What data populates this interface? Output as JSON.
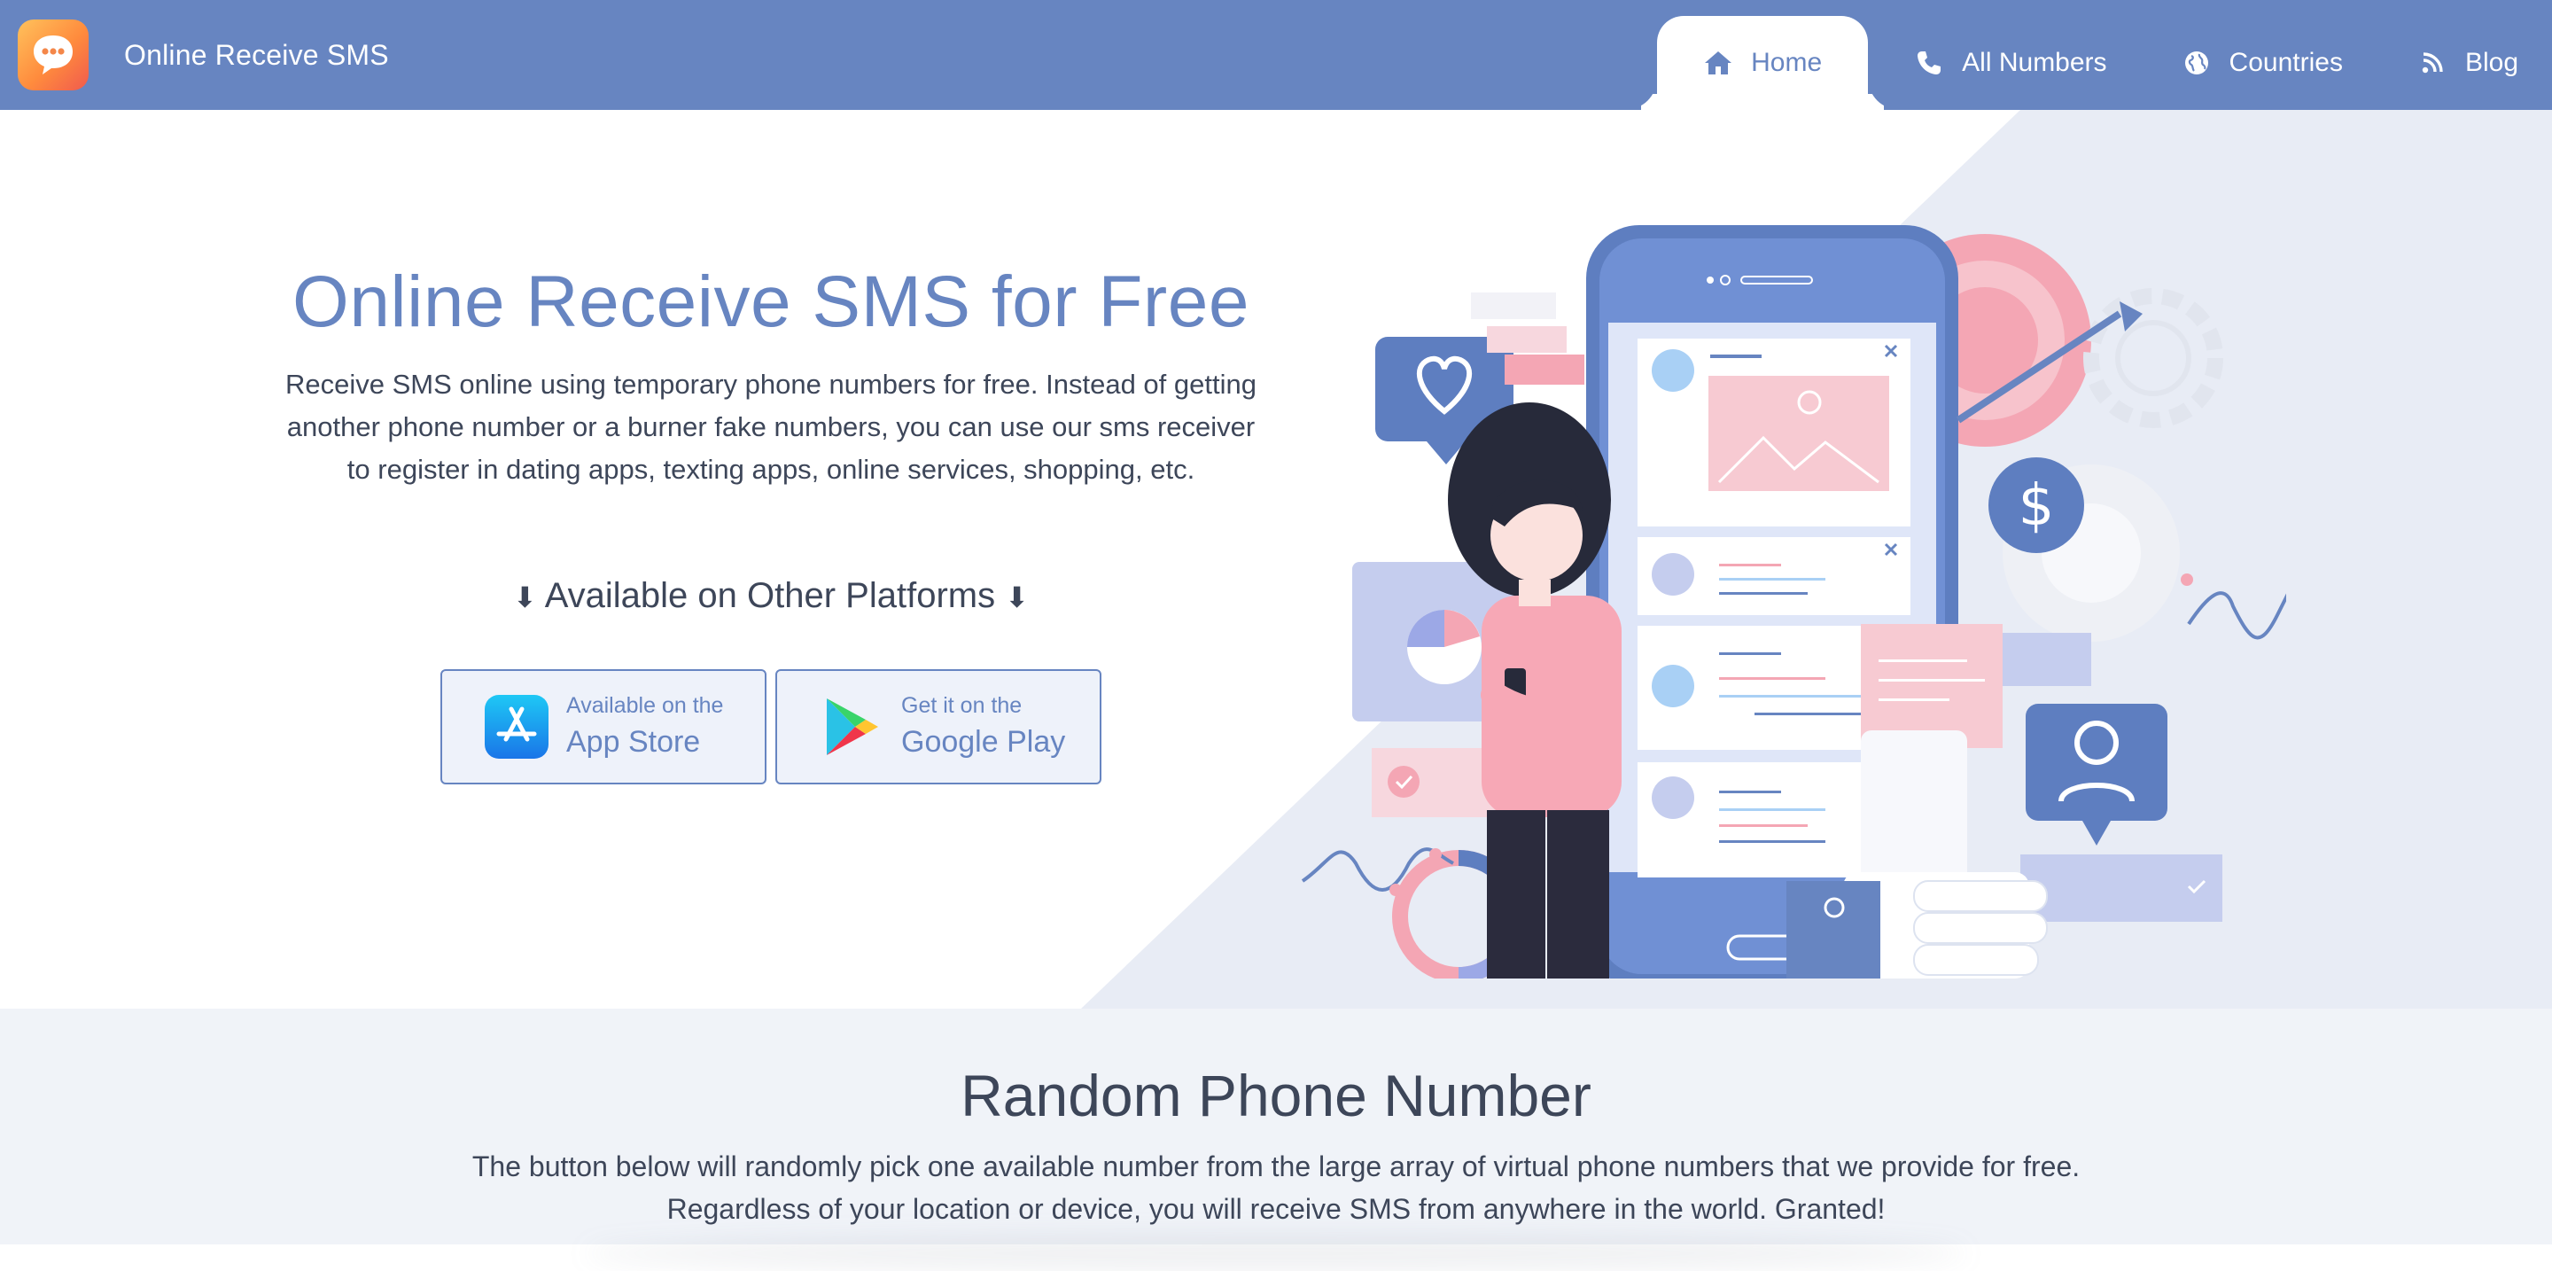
{
  "brand": {
    "name": "Online Receive SMS",
    "icon": "chat-bubble-icon"
  },
  "nav": {
    "items": [
      {
        "label": "Home",
        "icon": "home-icon",
        "active": true
      },
      {
        "label": "All Numbers",
        "icon": "phone-icon",
        "active": false
      },
      {
        "label": "Countries",
        "icon": "globe-icon",
        "active": false
      },
      {
        "label": "Blog",
        "icon": "rss-icon",
        "active": false
      }
    ]
  },
  "hero": {
    "title": "Online Receive SMS for Free",
    "description": "Receive SMS online using temporary phone numbers for free. Instead of getting another phone number or a burner fake numbers, you can use our sms receiver to register in dating apps, texting apps, online services, shopping, etc.",
    "platforms_title": "Available on Other Platforms",
    "platforms_arrow": "⬇",
    "stores": [
      {
        "small": "Available on the",
        "big": "App Store",
        "icon": "app-store-icon"
      },
      {
        "small": "Get it on the",
        "big": "Google Play",
        "icon": "google-play-icon"
      }
    ]
  },
  "random": {
    "title": "Random Phone Number",
    "line1": "The button below will randomly pick one available number from the large array of virtual phone numbers that we provide for free.",
    "line2": "Regardless of your location or device, you will receive SMS from anywhere in the world. Granted!"
  },
  "colors": {
    "primary": "#6785c1",
    "text": "#3d4659",
    "hero_bg_right": "#e8ecf5",
    "section_bg": "#f0f3f8",
    "accent_pink": "#f4a6b4"
  }
}
